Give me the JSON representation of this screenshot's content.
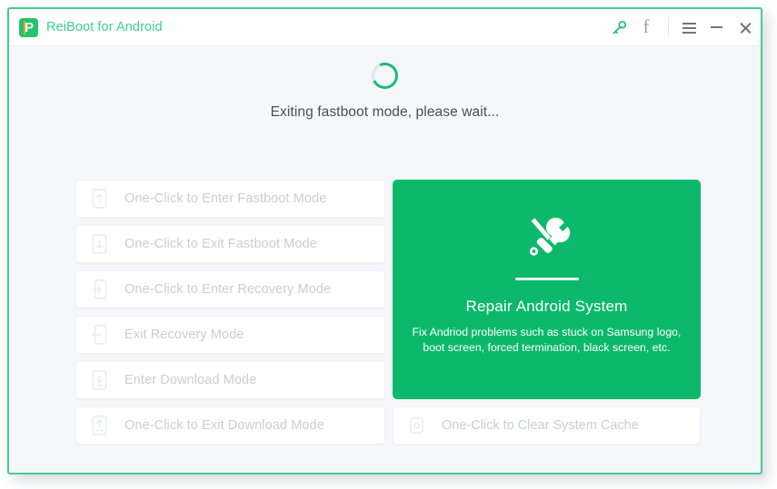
{
  "window": {
    "title": "ReiBoot for Android",
    "logo_icon": "reiboot-flag-logo",
    "accent_color": "#3ecf8e",
    "background_color": "#f5f7fa"
  },
  "titlebar": {
    "actions": [
      {
        "name": "register-key-icon",
        "icon": "key-icon",
        "label": ""
      },
      {
        "name": "facebook-icon",
        "icon": "facebook-icon",
        "label": "f"
      },
      {
        "name": "menu-button",
        "icon": "hamburger-icon",
        "label": ""
      },
      {
        "name": "minimize-button",
        "icon": "minimize-icon",
        "label": ""
      },
      {
        "name": "close-button",
        "icon": "close-icon",
        "label": ""
      }
    ]
  },
  "status": {
    "spinner_icon": "loading-spinner-icon",
    "message": "Exiting fastboot mode, please wait...",
    "spinner_color": "#14c06e"
  },
  "mode_buttons": [
    {
      "label": "One-Click to Enter Fastboot Mode",
      "icon": "phone-arrow-up-icon",
      "disabled": true
    },
    {
      "label": "One-Click to Exit Fastboot Mode",
      "icon": "phone-arrow-down-icon",
      "disabled": true
    },
    {
      "label": "One-Click to Enter Recovery Mode",
      "icon": "phone-arrow-right-in-icon",
      "disabled": true
    },
    {
      "label": "Exit Recovery Mode",
      "icon": "phone-arrow-left-out-icon",
      "disabled": true
    },
    {
      "label": "Enter Download Mode",
      "icon": "phone-download-icon",
      "disabled": true
    },
    {
      "label": "One-Click to Exit Download Mode",
      "icon": "phone-upload-icon",
      "disabled": true
    }
  ],
  "repair_card": {
    "icon": "screwdriver-wrench-icon",
    "title": "Repair Android System",
    "description": "Fix Andriod problems such as stuck on Samsung logo, boot screen, forced termination, black screen, etc.",
    "background_color": "#0cb96b"
  },
  "cache_button": {
    "label": "One-Click to Clear System Cache",
    "icon": "phone-cache-icon",
    "disabled": true
  }
}
